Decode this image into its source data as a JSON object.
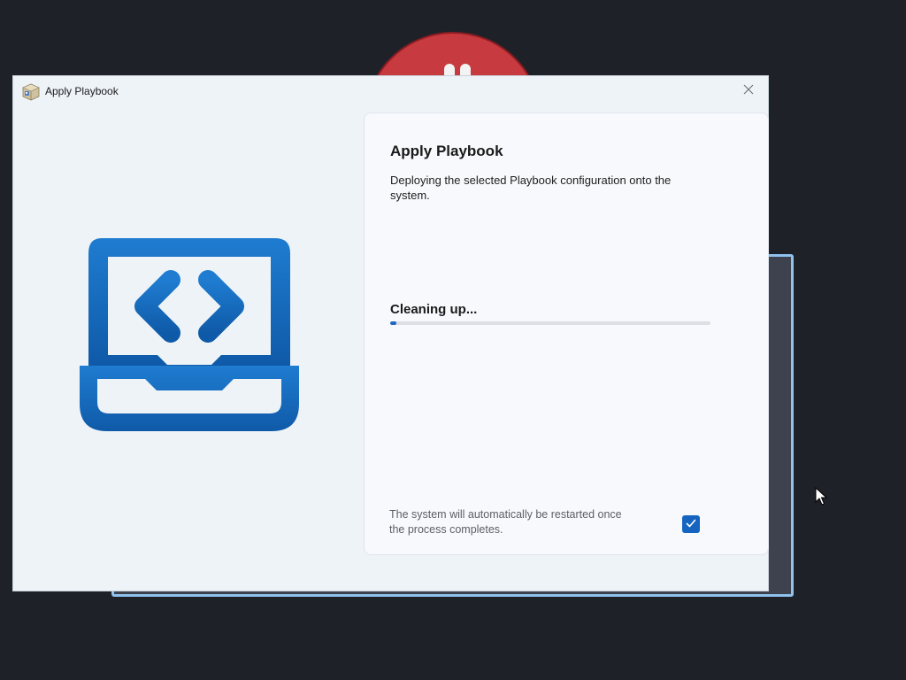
{
  "background": {
    "accent_color": "#c73a3f",
    "window_border_color": "#8fc2ee"
  },
  "dialog": {
    "title": "Apply Playbook",
    "app_icon": "package-icon",
    "close_icon": "close-icon",
    "illustration_icon": "laptop-code-icon",
    "illustration_color": "#1a6fc0"
  },
  "panel": {
    "title": "Apply Playbook",
    "description": "Deploying the selected Playbook configuration onto the system.",
    "status": "Cleaning up...",
    "progress_fraction": 0.02,
    "progress_color": "#1f69c0",
    "restart_note": "The system will automatically be restarted once the process completes.",
    "restart_checked": true
  }
}
